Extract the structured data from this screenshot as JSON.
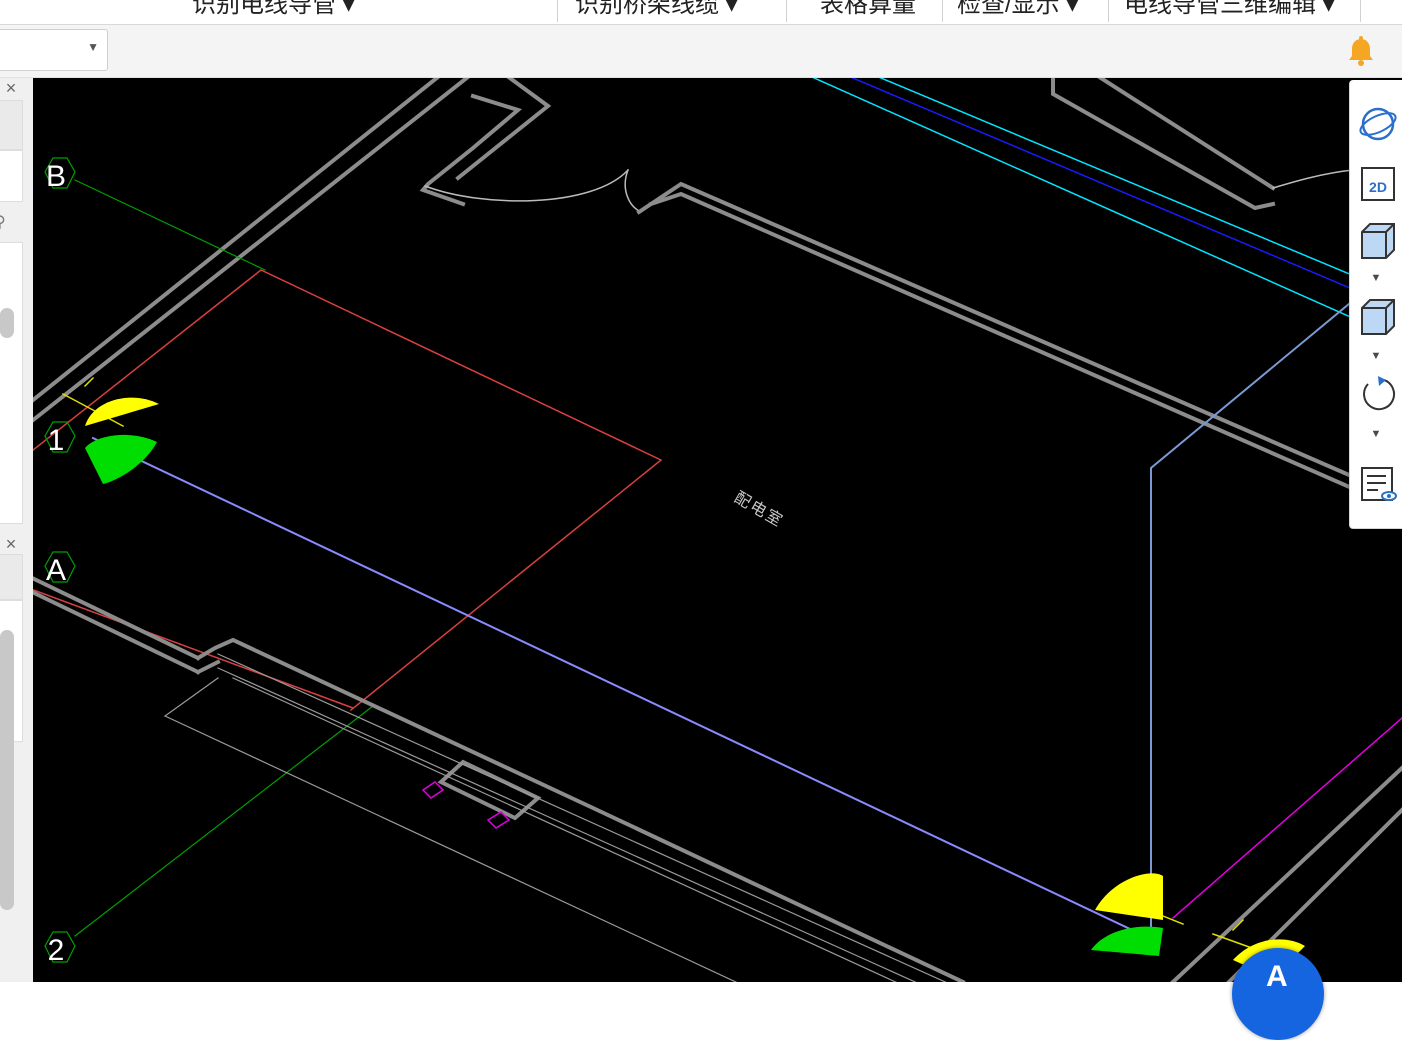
{
  "menu": {
    "items": [
      {
        "label": "识别电线导管"
      },
      {
        "label": "识别桥架线缆"
      },
      {
        "label": "表格算量"
      },
      {
        "label": "检查/显示"
      },
      {
        "label": "电线导管三维编辑"
      }
    ]
  },
  "toolbar": {
    "combo_value": "",
    "bell_icon": "bell-icon"
  },
  "left_panel": {
    "close_glyph": "×",
    "search_icon": "search-icon"
  },
  "canvas": {
    "axis_labels": [
      "B",
      "1",
      "A",
      "2"
    ],
    "room_label": "配电室",
    "colors": {
      "background": "#000000",
      "wall": "#8c8c8c",
      "axis": "#00a000",
      "red_line": "#e04040",
      "blue_line": "#8a8aff",
      "cyan": "#00e5ff",
      "magenta": "#e000e0",
      "yellow": "#ffff00",
      "green": "#00dd00"
    }
  },
  "view_toolbar": {
    "buttons": [
      {
        "name": "orbit-icon"
      },
      {
        "name": "2d-view-icon",
        "label": "2D"
      },
      {
        "name": "3d-box-icon"
      },
      {
        "name": "3d-box-alt-icon"
      },
      {
        "name": "rotate-icon"
      },
      {
        "name": "display-settings-icon"
      }
    ]
  },
  "fab": {
    "glyph": "A"
  }
}
